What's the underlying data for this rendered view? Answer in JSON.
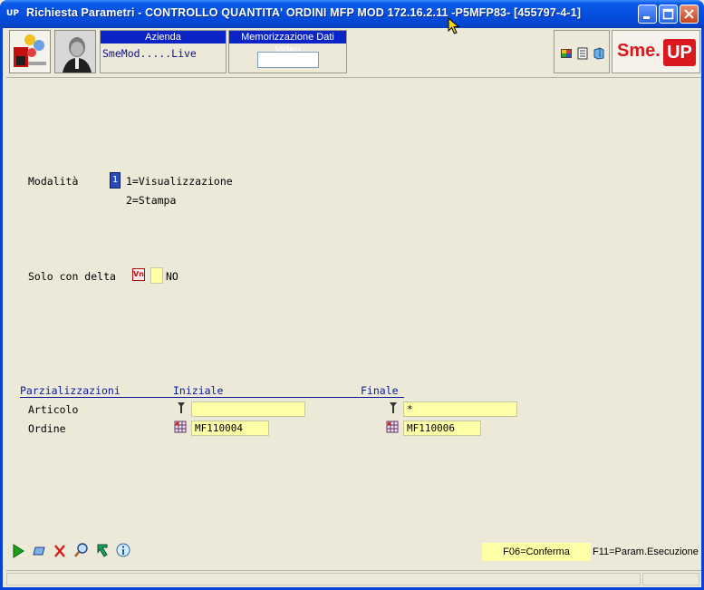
{
  "window": {
    "title": "Richiesta Parametri -  CONTROLLO QUANTITA' ORDINI MFP MOD 172.16.2.11 -P5MFP83- [455797-4-1]",
    "app_icon": "UP"
  },
  "toolbar": {
    "azienda_label": "Azienda",
    "azienda_value": "SmeMod.....Live",
    "memorizzazione_label": "Memorizzazione Dati Video",
    "logo_text_sme": "Sme.",
    "logo_text_up": "UP"
  },
  "form": {
    "modalita_label": "Modalità",
    "modalita_value": "1",
    "modalita_option1": "1=Visualizzazione",
    "modalita_option2": "2=Stampa",
    "solo_delta_label": "Solo con delta",
    "solo_delta_value": "NO",
    "vn_icon_text": "Vn"
  },
  "parzializzazioni": {
    "header_label": "Parzializzazioni",
    "header_iniziale": "Iniziale",
    "header_finale": "Finale",
    "rows": [
      {
        "label": "Articolo",
        "iniziale": "",
        "finale": "*"
      },
      {
        "label": "Ordine",
        "iniziale": "MF110004",
        "finale": "MF110006"
      }
    ]
  },
  "function_keys": {
    "f06": "F06=Conferma",
    "f11": "F11=Param.Esecuzione"
  },
  "colors": {
    "titlebar": "#0550e0",
    "field_yellow": "#ffffa8",
    "heading_blue": "#0a1a9a",
    "logo_red": "#d9191f"
  }
}
